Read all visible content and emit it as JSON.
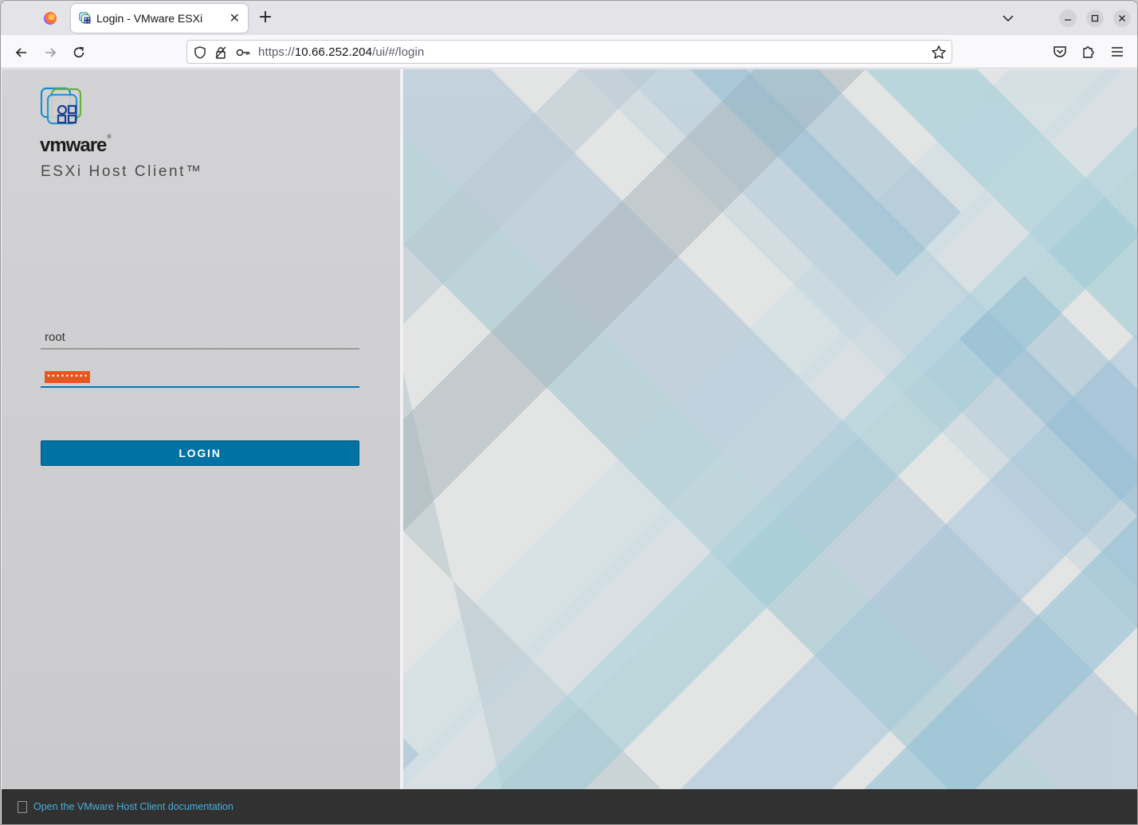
{
  "browser": {
    "tab_title": "Login - VMware ESXi",
    "url_prefix": "https://",
    "url_host": "10.66.252.204",
    "url_path": "/ui/#/login"
  },
  "login": {
    "brand": "vmware",
    "product_name": "ESXi Host Client™",
    "username_value": "root",
    "password_mask": "•••••••••",
    "login_label": "LOGIN"
  },
  "footer": {
    "doc_link": "Open the VMware Host Client documentation"
  },
  "colors": {
    "accent": "#0072a3",
    "password_highlight": "#e8561f",
    "footer_bg": "#313131",
    "link": "#49afd9"
  }
}
